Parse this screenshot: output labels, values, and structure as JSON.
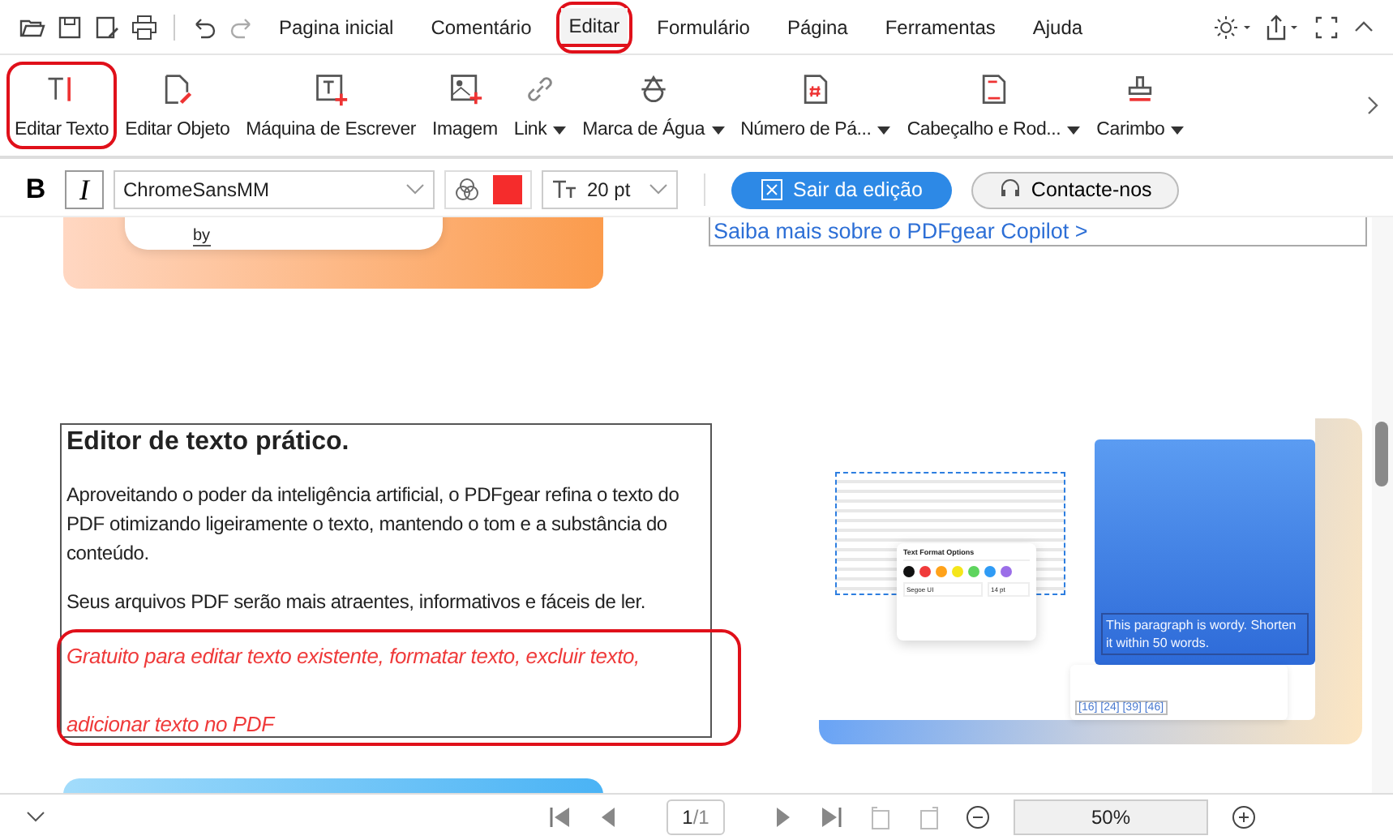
{
  "menu_tabs": [
    {
      "label": "Pagina inicial",
      "selected": false,
      "circled": false
    },
    {
      "label": "Comentário",
      "selected": false,
      "circled": false
    },
    {
      "label": "Editar",
      "selected": true,
      "circled": true
    },
    {
      "label": "Formulário",
      "selected": false,
      "circled": false
    },
    {
      "label": "Página",
      "selected": false,
      "circled": false
    },
    {
      "label": "Ferramentas",
      "selected": false,
      "circled": false
    },
    {
      "label": "Ajuda",
      "selected": false,
      "circled": false
    }
  ],
  "ribbon_tools": [
    {
      "kind": "text",
      "label": "Editar Texto",
      "dropdown": false,
      "circled": true
    },
    {
      "kind": "object",
      "label": "Editar Objeto",
      "dropdown": false,
      "circled": false
    },
    {
      "kind": "typewriter",
      "label": "Máquina de Escrever",
      "dropdown": false,
      "circled": false
    },
    {
      "kind": "image",
      "label": "Imagem",
      "dropdown": false,
      "circled": false
    },
    {
      "kind": "link",
      "label": "Link",
      "dropdown": true,
      "circled": false
    },
    {
      "kind": "watermark",
      "label": "Marca de Água",
      "dropdown": true,
      "circled": false
    },
    {
      "kind": "pagenumber",
      "label": "Número de Pá...",
      "dropdown": true,
      "circled": false
    },
    {
      "kind": "header",
      "label": "Cabeçalho e Rod...",
      "dropdown": true,
      "circled": false
    },
    {
      "kind": "stamp",
      "label": "Carimbo",
      "dropdown": true,
      "circled": false
    }
  ],
  "format_bar": {
    "bold": "B",
    "italic": "I",
    "font": "ChromeSansMM",
    "color": "#f52c2c",
    "size": "20 pt",
    "exit_button": "Sair da edição",
    "contact_button": "Contacte-nos"
  },
  "document": {
    "card_text": "by",
    "link": "Saiba mais sobre o PDFgear Copilot >",
    "heading": "Editor de texto prático.",
    "paragraphs": [
      "Aproveitando o poder da inteligência artificial, o PDFgear refina o texto do PDF otimizando ligeiramente o texto, mantendo o tom e a substância do conteúdo.",
      "Seus arquivos PDF serão mais atraentes, informativos e fáceis de ler."
    ],
    "highlight": {
      "text": "Gratuito para editar texto existente, formatar texto, excluir texto, adicionar texto no PDF",
      "circled": true
    },
    "illustration": {
      "popup_title": "Text Format Options",
      "swatches": [
        {
          "color": "#111111"
        },
        {
          "color": "#f03a3a"
        },
        {
          "color": "#ffa21a"
        },
        {
          "color": "#f5e61a"
        },
        {
          "color": "#5ed45e"
        },
        {
          "color": "#2f9bf5"
        },
        {
          "color": "#9b6ee8"
        }
      ],
      "font": "Segoe UI",
      "size": "14 pt",
      "ai_text": "This paragraph is wordy. Shorten it within 50 words.",
      "refs": "[16] [24] [39] [46]"
    }
  },
  "pager": {
    "page": "1",
    "total": "/1",
    "zoom": "50%"
  }
}
